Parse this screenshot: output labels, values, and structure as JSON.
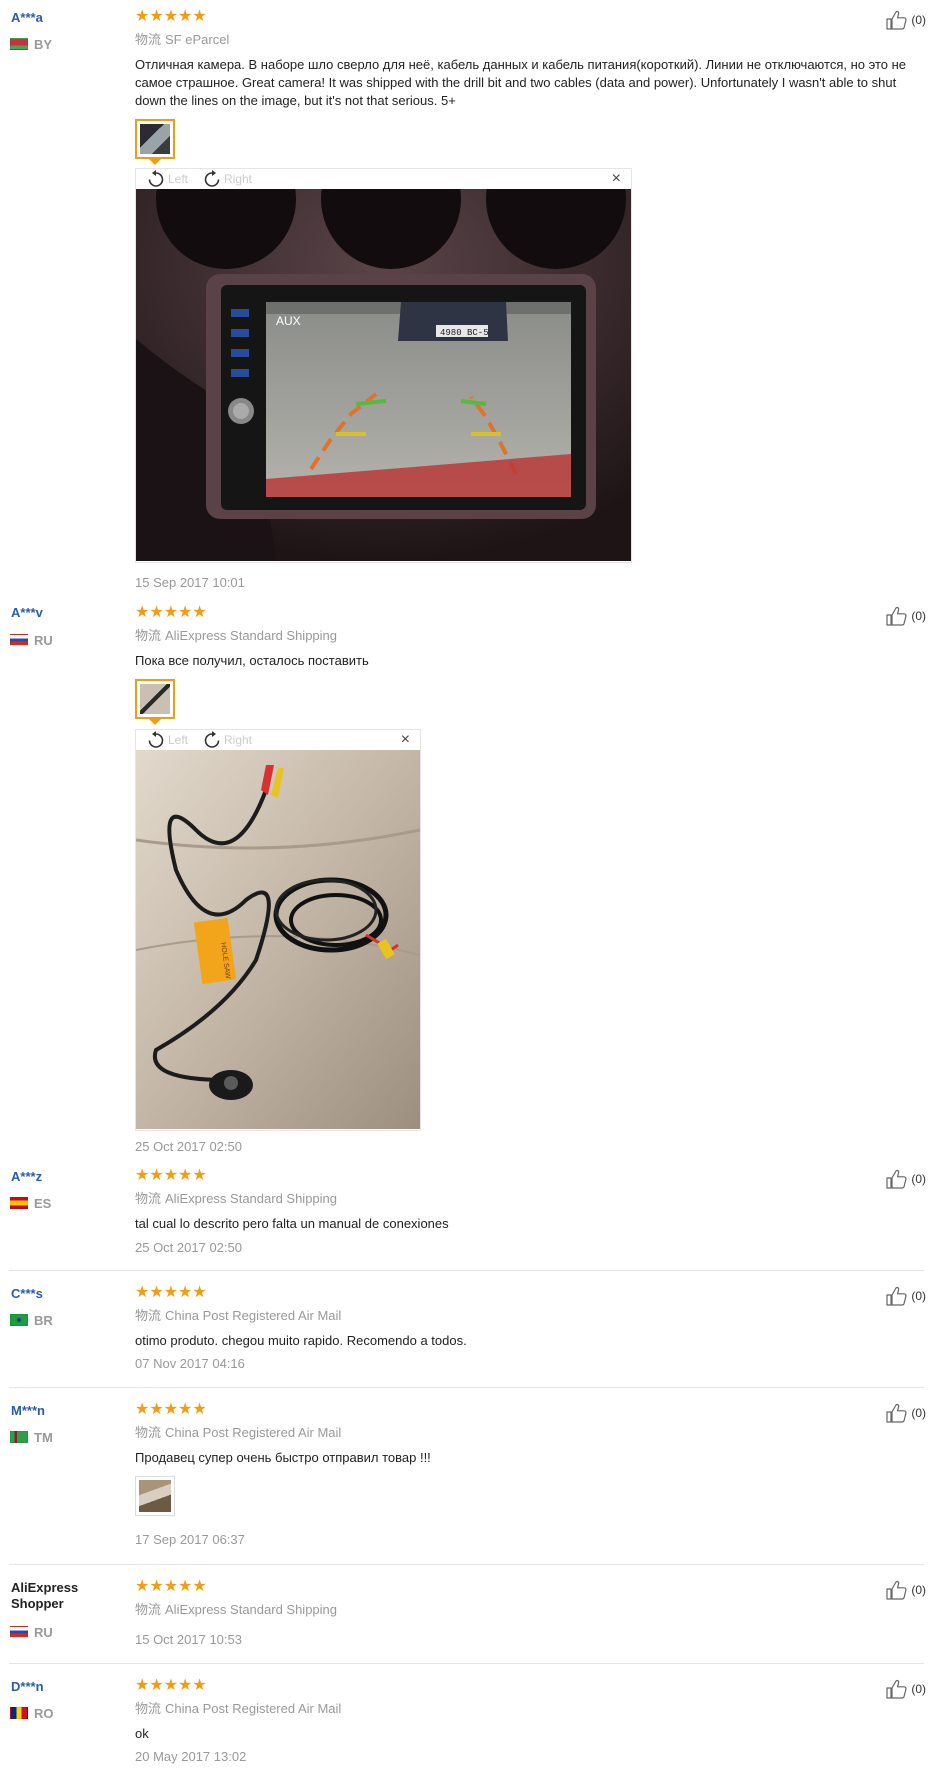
{
  "reviews": [
    {
      "user": "A***a",
      "country": "BY",
      "stars": "★★★★★",
      "shipping_label": "物流",
      "shipping": "SF eParcel",
      "text": "Отличная камера. В наборе шло сверло для неё, кабель данных и кабель питания(короткий). Линии не отключаются, но это не самое страшное. Great camera! It was shipped with the drill bit and two cables (data and power). Unfortunately I wasn't able to shut down the lines on the image, but it's not that serious. 5+",
      "date": "15 Sep 2017 10:01",
      "likes": "(0)"
    },
    {
      "user": "A***v",
      "country": "RU",
      "stars": "★★★★★",
      "shipping_label": "物流",
      "shipping": "AliExpress Standard Shipping",
      "text": "Пока все получил, осталось поставить",
      "date": "25 Oct 2017 02:50",
      "likes": "(0)"
    },
    {
      "user": "A***z",
      "country": "ES",
      "stars": "★★★★★",
      "shipping_label": "物流",
      "shipping": "AliExpress Standard Shipping",
      "text": "tal cual lo descrito pero falta un manual de conexiones",
      "date": "25 Oct 2017 02:50",
      "likes": "(0)"
    },
    {
      "user": "C***s",
      "country": "BR",
      "stars": "★★★★★",
      "shipping_label": "物流",
      "shipping": "China Post Registered Air Mail",
      "text": "otimo produto. chegou muito rapido. Recomendo a todos.",
      "date": "07 Nov 2017 04:16",
      "likes": "(0)"
    },
    {
      "user": "M***n",
      "country": "TM",
      "stars": "★★★★★",
      "shipping_label": "物流",
      "shipping": "China Post Registered Air Mail",
      "text": "Продавец супер очень быстро отправил товар !!!",
      "date": "17 Sep 2017 06:37",
      "likes": "(0)"
    },
    {
      "user": "AliExpress Shopper",
      "country": "RU",
      "stars": "★★★★★",
      "shipping_label": "物流",
      "shipping": "AliExpress Standard Shipping",
      "text": "",
      "date": "15 Oct 2017 10:53",
      "likes": "(0)"
    },
    {
      "user": "D***n",
      "country": "RO",
      "stars": "★★★★★",
      "shipping_label": "物流",
      "shipping": "China Post Registered Air Mail",
      "text": "ok",
      "date": "20 May 2017 13:02",
      "likes": "(0)"
    }
  ],
  "viewer": {
    "left_label": "Left",
    "right_label": "Right",
    "close": "×"
  },
  "colors": {
    "star": "#f39c11",
    "username": "#2a5caa",
    "muted": "#999999"
  },
  "icons": [
    "thumbs-up-icon",
    "rotate-left-icon",
    "rotate-right-icon",
    "close-icon"
  ],
  "photo_overlay_text": {
    "screen_label": "AUX",
    "plate": "4980 BC-5",
    "sticker": "HOLE SAW"
  }
}
